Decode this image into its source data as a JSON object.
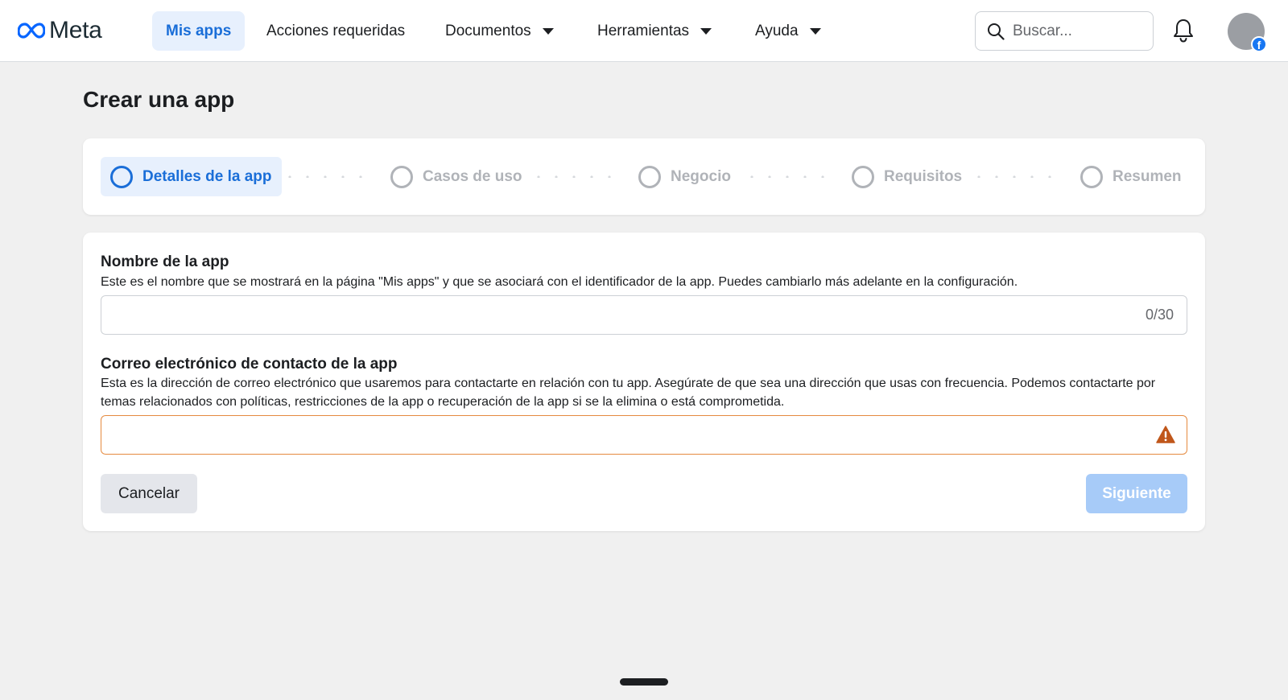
{
  "header": {
    "logo_text": "Meta",
    "nav": [
      {
        "label": "Mis apps",
        "active": true,
        "dropdown": false
      },
      {
        "label": "Acciones requeridas",
        "active": false,
        "dropdown": false
      },
      {
        "label": "Documentos",
        "active": false,
        "dropdown": true
      },
      {
        "label": "Herramientas",
        "active": false,
        "dropdown": true
      },
      {
        "label": "Ayuda",
        "active": false,
        "dropdown": true
      }
    ],
    "search": {
      "placeholder": "Buscar...",
      "value": "",
      "icon": "search-icon"
    },
    "notifications_icon": "bell-icon",
    "avatar_badge": "f"
  },
  "page": {
    "title": "Crear una app"
  },
  "stepper": {
    "steps": [
      {
        "label": "Detalles de la app",
        "active": true
      },
      {
        "label": "Casos de uso",
        "active": false
      },
      {
        "label": "Negocio",
        "active": false
      },
      {
        "label": "Requisitos",
        "active": false
      },
      {
        "label": "Resumen",
        "active": false
      }
    ]
  },
  "form": {
    "app_name": {
      "label": "Nombre de la app",
      "description": "Este es el nombre que se mostrará en la página \"Mis apps\" y que se asociará con el identificador de la app. Puedes cambiarlo más adelante en la configuración.",
      "value": "",
      "counter": "0/30"
    },
    "contact_email": {
      "label": "Correo electrónico de contacto de la app",
      "description": "Esta es la dirección de correo electrónico que usaremos para contactarte en relación con tu app. Asegúrate de que sea una dirección que usas con frecuencia. Podemos contactarte por temas relacionados con políticas, restricciones de la app o recuperación de la app si se la elimina o está comprometida.",
      "value": "",
      "status_icon": "warning-icon"
    },
    "cancel_label": "Cancelar",
    "next_label": "Siguiente"
  },
  "colors": {
    "accent": "#1a6ed8",
    "accent_bg": "#e7f0fd",
    "warning": "#c0571b",
    "next_disabled": "#a7cbf8"
  }
}
